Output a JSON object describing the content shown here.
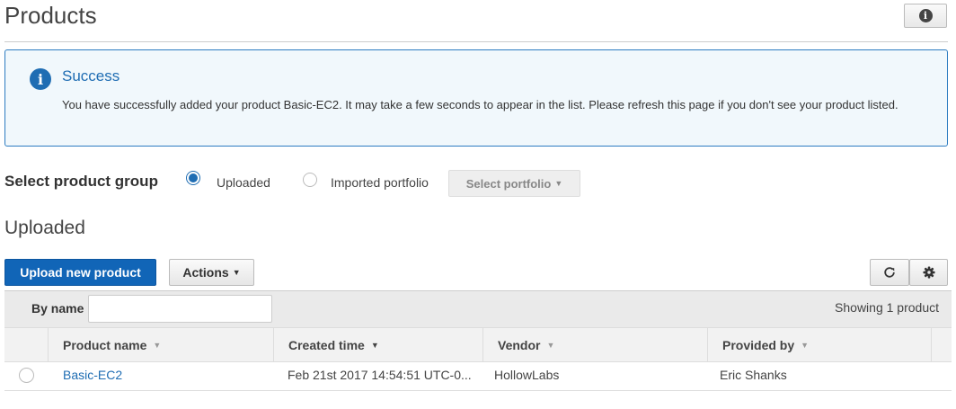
{
  "page": {
    "title": "Products"
  },
  "alert": {
    "title": "Success",
    "message": "You have successfully added your product Basic-EC2. It may take a few seconds to appear in the list. Please refresh this page if you don't see your product listed."
  },
  "group_select": {
    "label": "Select product group",
    "options": [
      {
        "label": "Uploaded",
        "selected": true
      },
      {
        "label": "Imported portfolio",
        "selected": false
      }
    ],
    "portfolio_button": "Select portfolio"
  },
  "section": {
    "title": "Uploaded"
  },
  "toolbar": {
    "upload_label": "Upload new product",
    "actions_label": "Actions"
  },
  "filter": {
    "label": "By name",
    "value": "",
    "placeholder": "",
    "count_text": "Showing 1 product"
  },
  "table": {
    "columns": [
      "Product name",
      "Created time",
      "Vendor",
      "Provided by"
    ],
    "rows": [
      {
        "product_name": "Basic-EC2",
        "created_time": "Feb 21st 2017 14:54:51 UTC-0...",
        "vendor": "HollowLabs",
        "provided_by": "Eric Shanks"
      }
    ]
  },
  "colors": {
    "primary": "#1165b7",
    "alert_border": "#2d7cc1",
    "alert_bg": "#f1f8fc",
    "link": "#1f6db3"
  },
  "icons": [
    "info-icon",
    "alert-info-icon",
    "caret-down-icon",
    "refresh-icon",
    "gear-icon",
    "sort-caret-icon"
  ]
}
